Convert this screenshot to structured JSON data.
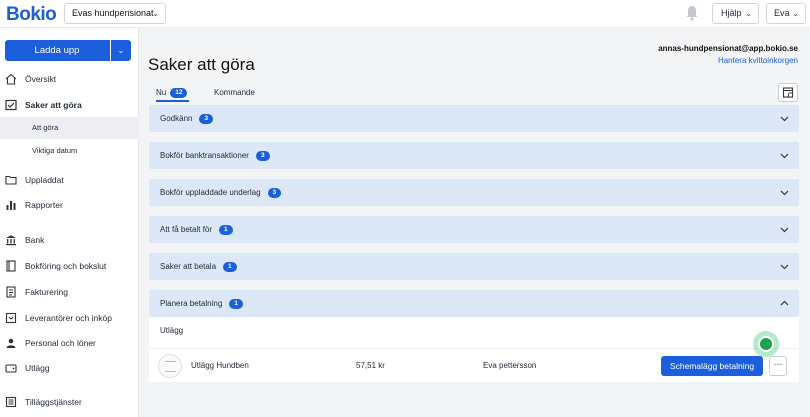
{
  "header": {
    "logo": "Bokio",
    "company": "Evas hundpensionat",
    "help": "Hjälp",
    "user": "Eva"
  },
  "sidebar": {
    "upload_label": "Ladda upp",
    "items": [
      {
        "label": "Översikt",
        "icon": "home-icon"
      },
      {
        "label": "Saker att göra",
        "icon": "checklist-icon",
        "active": true
      },
      {
        "label": "Uppladdat",
        "icon": "folder-icon"
      },
      {
        "label": "Rapporter",
        "icon": "bar-chart-icon"
      },
      {
        "label": "Bank",
        "icon": "bank-icon"
      },
      {
        "label": "Bokföring och bokslut",
        "icon": "book-icon"
      },
      {
        "label": "Fakturering",
        "icon": "invoice-icon"
      },
      {
        "label": "Leverantörer och inköp",
        "icon": "inbox-icon"
      },
      {
        "label": "Personal och löner",
        "icon": "person-icon"
      },
      {
        "label": "Utlägg",
        "icon": "wallet-icon"
      },
      {
        "label": "Tilläggstjänster",
        "icon": "addons-icon"
      }
    ],
    "sub_items": [
      {
        "label": "Att göra",
        "selected": true
      },
      {
        "label": "Viktiga datum",
        "selected": false
      }
    ]
  },
  "main": {
    "title": "Saker att göra",
    "email": "annas-hundpensionat@app.bokio.se",
    "inbox_link": "Hantera kvittoinkorgen",
    "tabs": [
      {
        "label": "Nu",
        "count": "12",
        "active": true
      },
      {
        "label": "Kommande",
        "active": false
      }
    ],
    "sections": [
      {
        "title": "Godkänn",
        "count": "3",
        "expanded": false
      },
      {
        "title": "Bokför banktransaktioner",
        "count": "3",
        "expanded": false
      },
      {
        "title": "Bokför uppladdade underlag",
        "count": "3",
        "expanded": false
      },
      {
        "title": "Att få betalt för",
        "count": "1",
        "expanded": false
      },
      {
        "title": "Saker att betala",
        "count": "1",
        "expanded": false
      },
      {
        "title": "Planera betalning",
        "count": "1",
        "expanded": true
      }
    ],
    "expanded": {
      "group_label": "Utlägg",
      "row": {
        "name": "Utlägg Hundben",
        "amount": "57,51 kr",
        "person": "Eva pettersson",
        "action": "Schemalägg betalning",
        "more": "···"
      }
    }
  },
  "colors": {
    "brand": "#1b5fdc",
    "section_bg": "#dce8f8",
    "cursor": "#16a34a"
  }
}
